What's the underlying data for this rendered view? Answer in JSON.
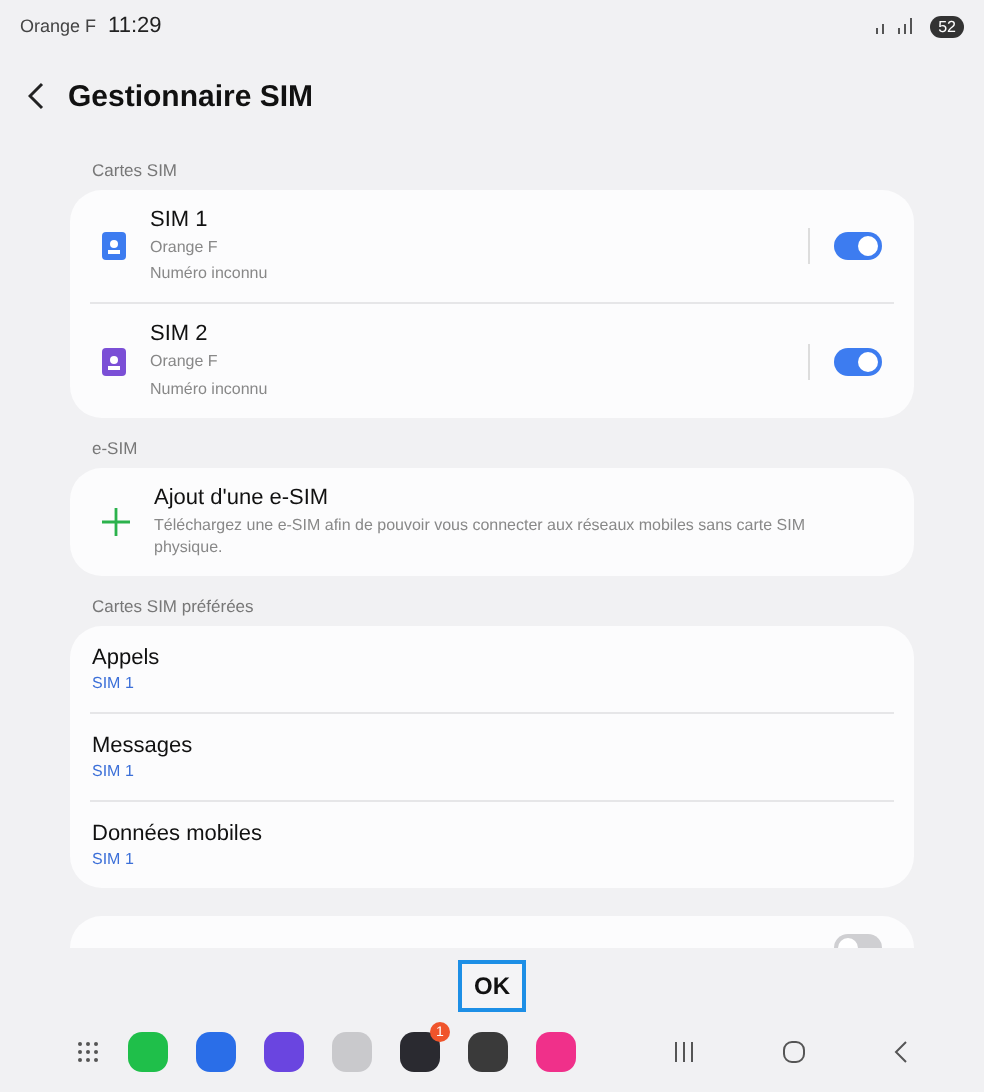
{
  "status_bar": {
    "carrier": "Orange F",
    "time": "11:29",
    "battery": "52"
  },
  "header": {
    "title": "Gestionnaire SIM"
  },
  "sim_section": {
    "label": "Cartes SIM",
    "sims": [
      {
        "name": "SIM 1",
        "operator": "Orange F",
        "number": "Numéro inconnu",
        "color": "#3d7cf0",
        "on": true
      },
      {
        "name": "SIM 2",
        "operator": "Orange F",
        "number": "Numéro inconnu",
        "color": "#7b4fd6",
        "on": true
      }
    ]
  },
  "esim_section": {
    "label": "e-SIM",
    "title": "Ajout d'une e-SIM",
    "description": "Téléchargez une e-SIM afin de pouvoir vous connecter aux réseaux mobiles sans carte SIM physique."
  },
  "preferred_section": {
    "label": "Cartes SIM préférées",
    "items": [
      {
        "title": "Appels",
        "value": "SIM 1"
      },
      {
        "title": "Messages",
        "value": "SIM 1"
      },
      {
        "title": "Données mobiles",
        "value": "SIM 1"
      }
    ]
  },
  "partial_card": {
    "on": false
  },
  "ok_button": {
    "label": "OK"
  },
  "dock": {
    "settings_badge": "1"
  }
}
